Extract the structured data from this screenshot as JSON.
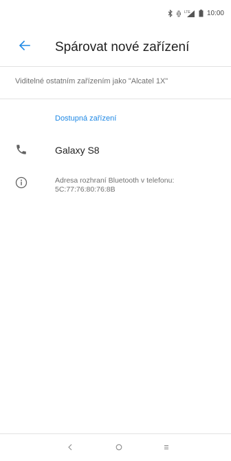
{
  "status_bar": {
    "time": "10:00",
    "icons": [
      "bluetooth-icon",
      "vibrate-icon",
      "signal-icon",
      "battery-icon"
    ],
    "signal_badge": "LTE"
  },
  "header": {
    "title": "Spárovat nové zařízení",
    "back_icon": "arrow-back-icon"
  },
  "visibility_text": "Viditelné ostatním zařízením jako \"Alcatel 1X\"",
  "available_devices": {
    "header": "Dostupná zařízení",
    "devices": [
      {
        "name": "Galaxy S8",
        "icon": "phone-icon"
      }
    ]
  },
  "info": {
    "icon": "info-icon",
    "line1": "Adresa rozhraní Bluetooth v telefonu:",
    "line2": "5C:77:76:80:76:8B"
  },
  "nav_bar": {
    "buttons": [
      "back-icon",
      "home-icon",
      "recents-icon"
    ]
  },
  "colors": {
    "accent": "#1e88e5",
    "text_primary": "#212121",
    "text_secondary": "#707070",
    "divider": "#e2e2e2",
    "icon_gray": "#616161"
  }
}
